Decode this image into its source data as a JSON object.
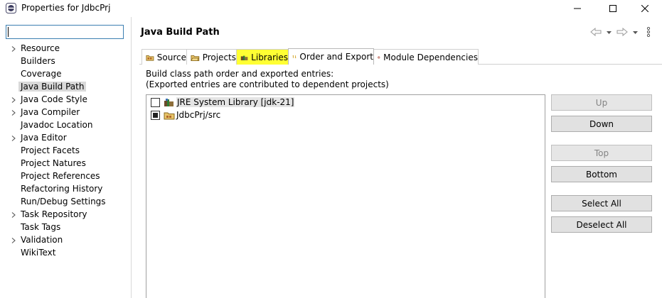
{
  "window": {
    "title": "Properties for JdbcPrj",
    "minimize_glyph": "—",
    "maximize_glyph": "☐",
    "close_glyph": "✕"
  },
  "sidebar": {
    "filter": {
      "value": "",
      "placeholder": ""
    },
    "items": [
      {
        "label": "Resource",
        "expandable": true,
        "selected": false
      },
      {
        "label": "Builders",
        "expandable": false,
        "selected": false
      },
      {
        "label": "Coverage",
        "expandable": false,
        "selected": false
      },
      {
        "label": "Java Build Path",
        "expandable": false,
        "selected": true
      },
      {
        "label": "Java Code Style",
        "expandable": true,
        "selected": false
      },
      {
        "label": "Java Compiler",
        "expandable": true,
        "selected": false
      },
      {
        "label": "Javadoc Location",
        "expandable": false,
        "selected": false
      },
      {
        "label": "Java Editor",
        "expandable": true,
        "selected": false
      },
      {
        "label": "Project Facets",
        "expandable": false,
        "selected": false
      },
      {
        "label": "Project Natures",
        "expandable": false,
        "selected": false
      },
      {
        "label": "Project References",
        "expandable": false,
        "selected": false
      },
      {
        "label": "Refactoring History",
        "expandable": false,
        "selected": false
      },
      {
        "label": "Run/Debug Settings",
        "expandable": false,
        "selected": false
      },
      {
        "label": "Task Repository",
        "expandable": true,
        "selected": false
      },
      {
        "label": "Task Tags",
        "expandable": false,
        "selected": false
      },
      {
        "label": "Validation",
        "expandable": true,
        "selected": false
      },
      {
        "label": "WikiText",
        "expandable": false,
        "selected": false
      }
    ]
  },
  "header": {
    "title": "Java Build Path"
  },
  "tabs": [
    {
      "label": "Source",
      "icon": "source-folder-icon",
      "active": false,
      "highlighted": false
    },
    {
      "label": "Projects",
      "icon": "projects-folder-icon",
      "active": false,
      "highlighted": false
    },
    {
      "label": "Libraries",
      "icon": "libraries-icon",
      "active": false,
      "highlighted": true
    },
    {
      "label": "Order and Export",
      "icon": "order-export-icon",
      "active": true,
      "highlighted": false
    },
    {
      "label": "Module Dependencies",
      "icon": "module-dependencies-icon",
      "active": false,
      "highlighted": false
    }
  ],
  "content": {
    "description_line1": "Build class path order and exported entries:",
    "description_line2": "(Exported entries are contributed to dependent projects)",
    "entries": [
      {
        "label": "JRE System Library [jdk-21]",
        "checked": false,
        "selected": true,
        "icon": "library-icon"
      },
      {
        "label": "JdbcPrj/src",
        "checked": true,
        "selected": false,
        "icon": "package-folder-icon"
      }
    ]
  },
  "buttons": {
    "up": {
      "label": "Up",
      "enabled": false
    },
    "down": {
      "label": "Down",
      "enabled": true
    },
    "top": {
      "label": "Top",
      "enabled": false
    },
    "bottom": {
      "label": "Bottom",
      "enabled": true
    },
    "select_all": {
      "label": "Select All",
      "enabled": true
    },
    "deselect_all": {
      "label": "Deselect All",
      "enabled": true
    }
  },
  "colors": {
    "highlight": "#ffff33",
    "selection": "#d9d9d9",
    "focus_border": "#3c7fb1"
  }
}
